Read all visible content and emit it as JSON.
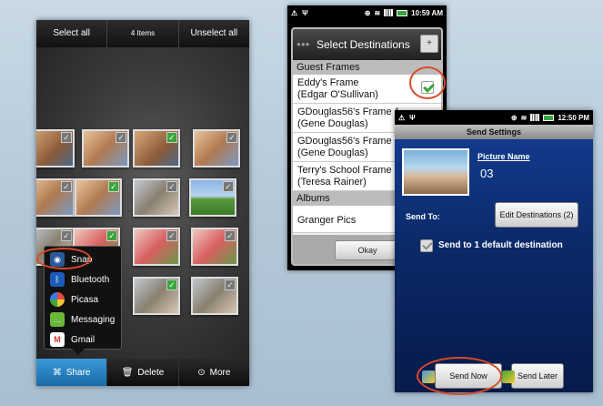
{
  "gallery": {
    "select_all": "Select all",
    "item_count": "4 Items",
    "unselect_all": "Unselect all",
    "thumbnails": [
      {
        "row": 1,
        "col": 1,
        "checked": false
      },
      {
        "row": 1,
        "col": 2,
        "checked": false
      },
      {
        "row": 1,
        "col": 3,
        "checked": true
      },
      {
        "row": 1,
        "col": 4,
        "checked": false
      },
      {
        "row": 2,
        "col": 1,
        "checked": false
      },
      {
        "row": 2,
        "col": 2,
        "checked": true
      },
      {
        "row": 2,
        "col": 3,
        "checked": false
      },
      {
        "row": 2,
        "col": 4,
        "checked": false
      },
      {
        "row": 3,
        "col": 1,
        "checked": false
      },
      {
        "row": 3,
        "col": 2,
        "checked": true
      },
      {
        "row": 3,
        "col": 3,
        "checked": false
      },
      {
        "row": 3,
        "col": 4,
        "checked": false
      },
      {
        "row": 4,
        "col": 3,
        "checked": true
      },
      {
        "row": 4,
        "col": 4,
        "checked": false
      }
    ],
    "share_menu": [
      "Snap",
      "Bluetooth",
      "Picasa",
      "Messaging",
      "Gmail"
    ],
    "bottom_bar": {
      "share": "Share",
      "delete": "Delete",
      "more": "More"
    }
  },
  "status_bar_1": {
    "time": "10:59 AM"
  },
  "status_bar_2": {
    "time": "12:50 PM"
  },
  "select_destinations": {
    "title": "Select Destinations",
    "plus": "+",
    "sections": [
      {
        "header": "Guest Frames",
        "items": [
          {
            "name": "Eddy's Frame",
            "owner": "(Edgar O'Sullivan)",
            "checked": true
          },
          {
            "name": "GDouglas56's Frame 1",
            "owner": "(Gene Douglas)",
            "checked": false
          },
          {
            "name": "GDouglas56's Frame",
            "owner": "(Gene Douglas)",
            "checked": false
          },
          {
            "name": "Terry's School Frame",
            "owner": "(Teresa Rainer)",
            "checked": false
          }
        ]
      },
      {
        "header": "Albums",
        "items": [
          {
            "name": "Granger Pics",
            "owner": "",
            "checked": false
          }
        ]
      }
    ],
    "okay": "Okay"
  },
  "send_settings": {
    "title": "Send Settings",
    "picture_name_label": "Picture Name",
    "picture_name_value": "03",
    "send_to_label": "Send To:",
    "edit_destinations": "Edit Destinations (2)",
    "default_destination": "Send to 1 default destination",
    "send_now": "Send Now",
    "send_later": "Send Later"
  },
  "colors": {
    "accent_highlight": "#d84a2a",
    "share_active": "#3a9ad8",
    "check_green": "#3aa53a",
    "send_bg": "#0b2a6a"
  }
}
